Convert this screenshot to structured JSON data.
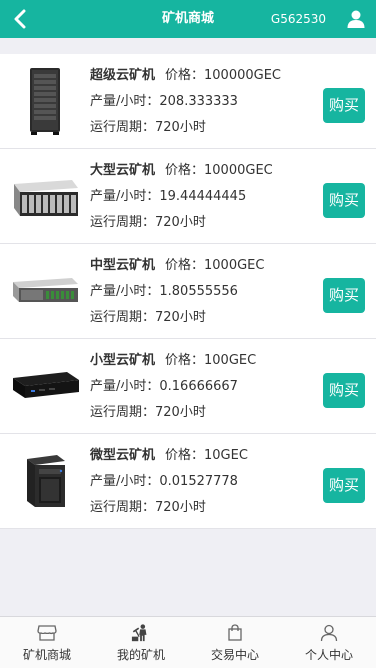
{
  "header": {
    "title": "矿机商城",
    "user_id": "G562530"
  },
  "products": [
    {
      "name": "超级云矿机",
      "price_label": "价格：100000GEC",
      "output_label": "产量/小时：208.333333",
      "period_label": "运行周期：720小时",
      "buy_label": "购买",
      "image": "tower-server"
    },
    {
      "name": "大型云矿机",
      "price_label": "价格：10000GEC",
      "output_label": "产量/小时：19.44444445",
      "period_label": "运行周期：720小时",
      "buy_label": "购买",
      "image": "rack-server-large"
    },
    {
      "name": "中型云矿机",
      "price_label": "价格：1000GEC",
      "output_label": "产量/小时：1.80555556",
      "period_label": "运行周期：720小时",
      "buy_label": "购买",
      "image": "rack-server-medium"
    },
    {
      "name": "小型云矿机",
      "price_label": "价格：100GEC",
      "output_label": "产量/小时：0.16666667",
      "period_label": "运行周期：720小时",
      "buy_label": "购买",
      "image": "mini-pc"
    },
    {
      "name": "微型云矿机",
      "price_label": "价格：10GEC",
      "output_label": "产量/小时：0.01527778",
      "period_label": "运行周期：720小时",
      "buy_label": "购买",
      "image": "nas-box"
    }
  ],
  "tabbar": {
    "items": [
      {
        "label": "矿机商城",
        "icon": "shop-icon"
      },
      {
        "label": "我的矿机",
        "icon": "miner-icon"
      },
      {
        "label": "交易中心",
        "icon": "bag-icon"
      },
      {
        "label": "个人中心",
        "icon": "person-icon"
      }
    ]
  },
  "colors": {
    "accent": "#16b5a0",
    "background": "#efeff4"
  }
}
